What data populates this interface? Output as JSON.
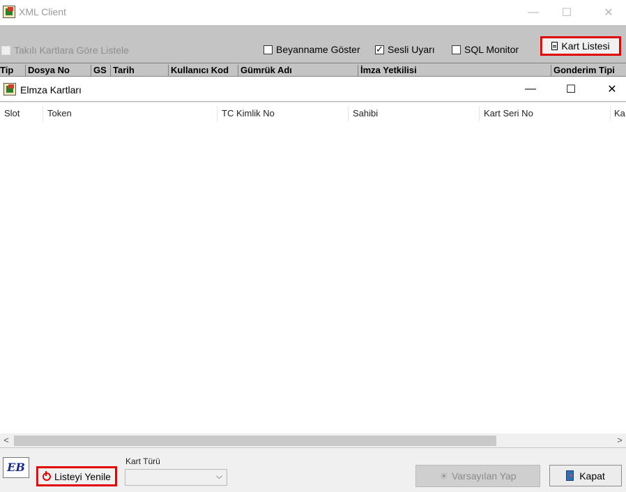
{
  "outer_window": {
    "title": "XML Client",
    "controls": {
      "minimize": "—",
      "maximize": "☐",
      "close": "✕"
    }
  },
  "toolbar": {
    "takili_kartlara_label": "Takılı Kartlara Göre Listele",
    "beyanname_goster_label": "Beyanname Göster",
    "beyanname_goster_checked": false,
    "sesli_uyari_label": "Sesli Uyarı",
    "sesli_uyari_checked": true,
    "sql_monitor_label": "SQL Monitor",
    "sql_monitor_checked": false,
    "kart_listesi_label": "Kart Listesi"
  },
  "outer_grid": {
    "columns": [
      "Tip",
      "Dosya No",
      "GS",
      "Tarih",
      "Kullanıcı Kod",
      "Gümrük Adı",
      "İmza Yetkilisi",
      "Gonderim Tipi"
    ]
  },
  "inner_window": {
    "title": "Elmza Kartları",
    "controls": {
      "minimize": "—",
      "maximize": "☐",
      "close": "✕"
    }
  },
  "card_list": {
    "columns": [
      "Slot",
      "Token",
      "TC Kimlik No",
      "Sahibi",
      "Kart Seri No",
      "Ka"
    ],
    "rows": []
  },
  "footer": {
    "logo_text": "EB",
    "listeyi_yenile_label": "Listeyi Yenile",
    "kart_turu_label": "Kart Türü",
    "kart_turu_value": "",
    "varsayilan_yap_label": "Varsayılan Yap",
    "kapat_label": "Kapat"
  },
  "colors": {
    "highlight_border": "#e10000",
    "toolbar_bg": "#c4c4c4",
    "window_bg": "#f0f0f0"
  }
}
